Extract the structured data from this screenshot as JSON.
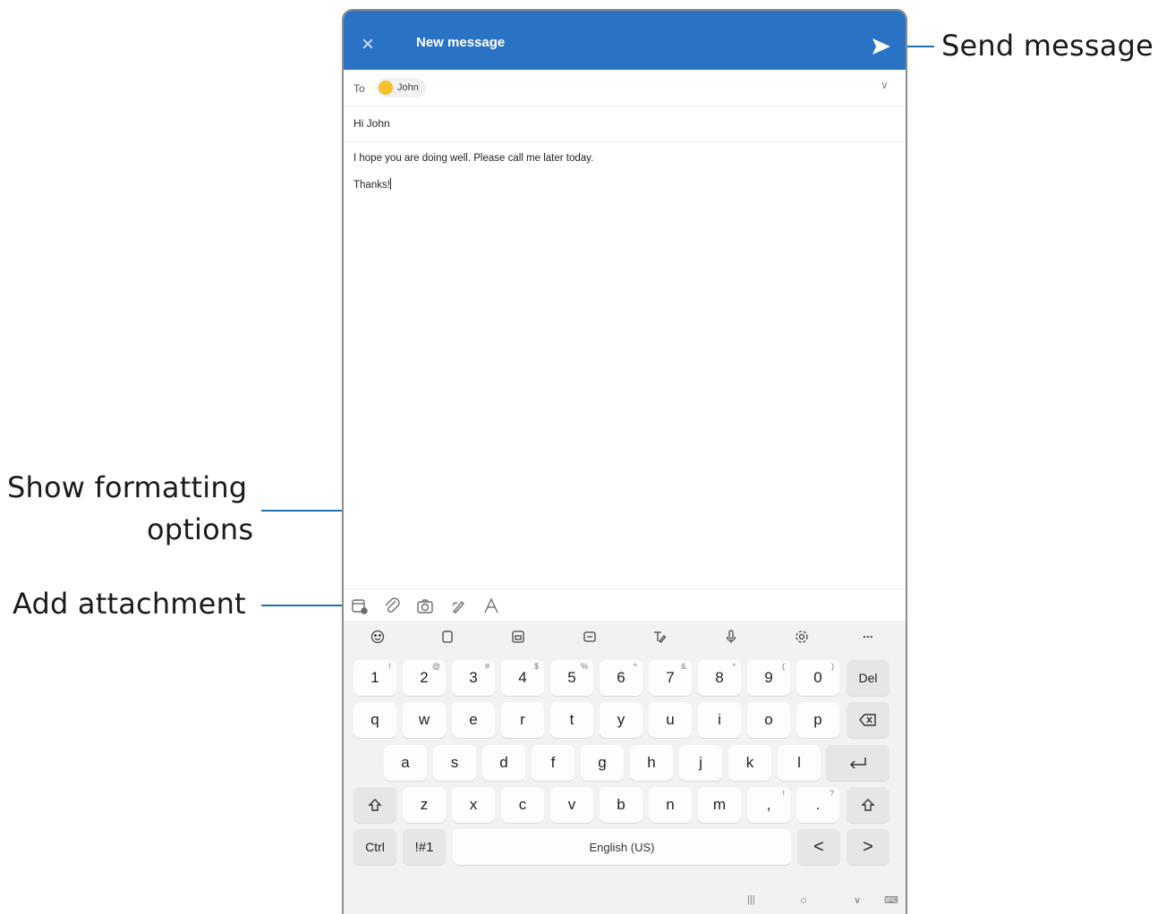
{
  "callouts": {
    "send": "Send message",
    "format_line1": "Show formatting",
    "format_line2": "options",
    "attach": "Add attachment"
  },
  "header": {
    "title": "New message",
    "close_icon": "close-icon",
    "send_icon": "send-icon"
  },
  "compose": {
    "to_label": "To",
    "recipient": "John",
    "subject": "Hi John",
    "body_line1": "I hope you are doing well. Please call me later today.",
    "body_line2": "Thanks!"
  },
  "toolbar_icons": [
    "calendar-attach-icon",
    "paperclip-icon",
    "camera-icon",
    "pen-icon",
    "text-format-icon"
  ],
  "keyboard": {
    "tools": [
      "emoji-icon",
      "clipboard-icon",
      "keyboard-mode-icon",
      "one-handed-icon",
      "handwriting-icon",
      "microphone-icon",
      "settings-icon",
      "more-icon"
    ],
    "more": "...",
    "row1": [
      {
        "k": "1",
        "s": "!"
      },
      {
        "k": "2",
        "s": "@"
      },
      {
        "k": "3",
        "s": "#"
      },
      {
        "k": "4",
        "s": "$"
      },
      {
        "k": "5",
        "s": "%"
      },
      {
        "k": "6",
        "s": "^"
      },
      {
        "k": "7",
        "s": "&"
      },
      {
        "k": "8",
        "s": "*"
      },
      {
        "k": "9",
        "s": "("
      },
      {
        "k": "0",
        "s": ")"
      }
    ],
    "del": "Del",
    "row2": [
      "q",
      "w",
      "e",
      "r",
      "t",
      "y",
      "u",
      "i",
      "o",
      "p"
    ],
    "row3": [
      "a",
      "s",
      "d",
      "f",
      "g",
      "h",
      "j",
      "k",
      "l"
    ],
    "row4": [
      "z",
      "x",
      "c",
      "v",
      "b",
      "n",
      "m"
    ],
    "comma": ",",
    "comma_sup": "!",
    "period": ".",
    "period_sup": "?",
    "ctrl": "Ctrl",
    "sym": "!#1",
    "space": "English (US)",
    "left": "<",
    "right": ">"
  },
  "navbar": {
    "recents": "|||",
    "home": "○",
    "back": "∨",
    "kb": "⌨"
  },
  "colors": {
    "appbar": "#2a72c4",
    "callout_line": "#1f6fb0",
    "chip_avatar": "#f5c22e"
  }
}
